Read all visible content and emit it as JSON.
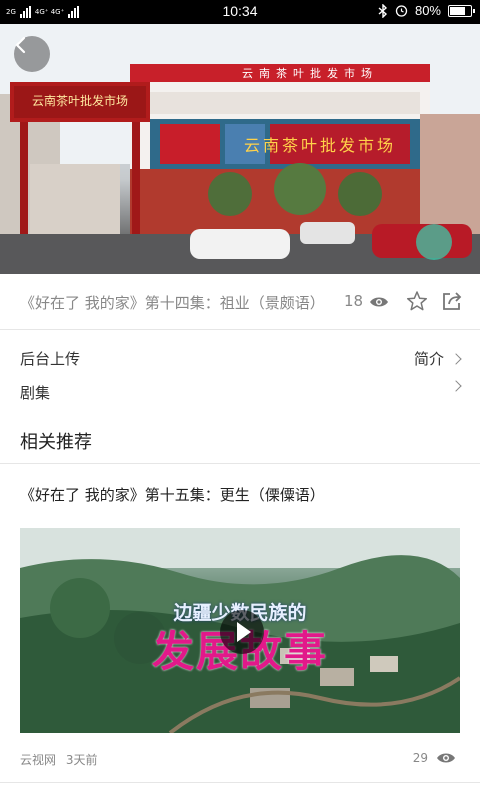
{
  "status_bar": {
    "network_tag_1": "2G",
    "network_tag_2": "4G⁺ 4G⁺",
    "network_tag_3": "2G",
    "time": "10:34",
    "battery_text": "80%",
    "battery_level": 0.8
  },
  "video": {
    "title": "《好在了 我的家》第十四集：祖业（景颇语）",
    "view_count": "18",
    "hero_sign_gate": "云南茶叶批发市场",
    "hero_sign_roof": "云南茶叶批发市场",
    "hero_sign_facade": "云南茶叶批发市场"
  },
  "rows": {
    "uploader_label": "后台上传",
    "intro_label": "简介",
    "episodes_label": "剧集"
  },
  "related": {
    "section_title": "相关推荐",
    "items": [
      {
        "title": "《好在了 我的家》第十五集：更生（傈僳语）",
        "overlay_line1": "边疆少数民族的",
        "overlay_line2": "发展故事",
        "source": "云视网",
        "time_ago": "3天前",
        "views": "29"
      }
    ]
  },
  "icons": {
    "back": "back-arrow-icon",
    "eye": "eye-icon",
    "star": "star-icon",
    "share": "share-icon",
    "chevron": "chevron-right-icon"
  },
  "colors": {
    "accent_magenta": "#e2198a",
    "text_gray": "#888888",
    "divider": "#e6e6e6"
  }
}
